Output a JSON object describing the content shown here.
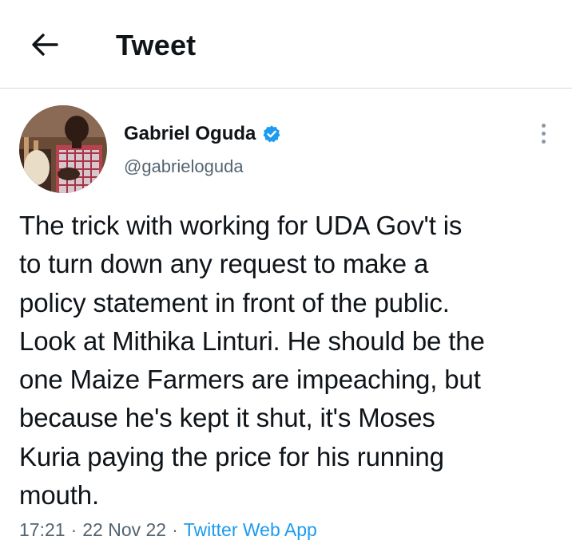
{
  "header": {
    "title": "Tweet",
    "back_icon": "arrow-left-icon"
  },
  "tweet": {
    "author_name": "Gabriel Oguda",
    "handle": "@gabrieloguda",
    "verified": true,
    "verified_color": "#1d9bf0",
    "text": "The trick with working for UDA Gov't is\nto turn down any request to make a\npolicy statement in front of the public.\nLook at Mithika Linturi. He should be the\none Maize Farmers are impeaching, but\nbecause he's kept it shut, it's Moses\nKuria paying the price for his running\nmouth.",
    "time": "17:21",
    "separator": "·",
    "date": "22 Nov 22",
    "source": "Twitter Web App",
    "more_icon": "more-vertical-icon"
  },
  "colors": {
    "text_primary": "#0f1419",
    "text_secondary": "#536471",
    "link": "#1d9bf0",
    "divider": "#d6d9db"
  }
}
